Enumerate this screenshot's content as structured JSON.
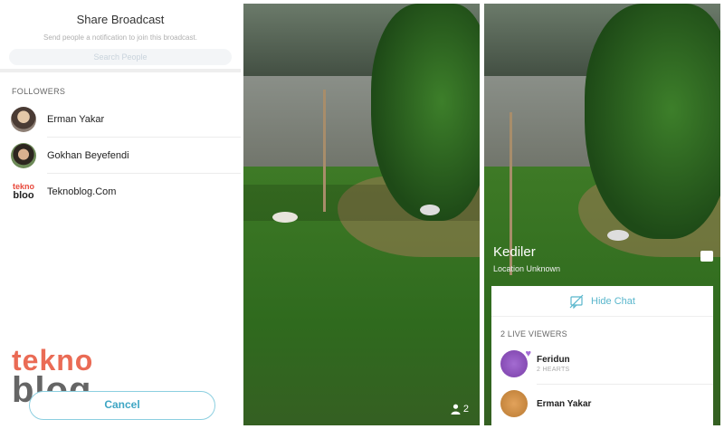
{
  "share": {
    "title": "Share Broadcast",
    "subtitle": "Send people a notification to join this broadcast.",
    "search_placeholder": "Search People",
    "followers_label": "FOLLOWERS",
    "followers": [
      {
        "name": "Erman Yakar"
      },
      {
        "name": "Gokhan Beyefendi"
      },
      {
        "name": "Teknoblog.Com"
      }
    ],
    "cancel_label": "Cancel",
    "teknoblog_avatar": {
      "top": "tekno",
      "bottom": "bloo"
    }
  },
  "watermark": {
    "top": "tekno",
    "bottom": "blog"
  },
  "broadcast": {
    "viewer_count": "2",
    "title": "Kediler",
    "location": "Location Unknown",
    "hide_chat_label": "Hide Chat",
    "live_viewers_label": "2 LIVE VIEWERS",
    "viewers": [
      {
        "name": "Feridun",
        "sub": "2 HEARTS"
      },
      {
        "name": "Erman Yakar",
        "sub": ""
      }
    ]
  },
  "colors": {
    "accent": "#3fa6c4",
    "hide_chat": "#59b6cc",
    "heart": "#a66ed6",
    "watermark_orange": "#e85c43"
  }
}
